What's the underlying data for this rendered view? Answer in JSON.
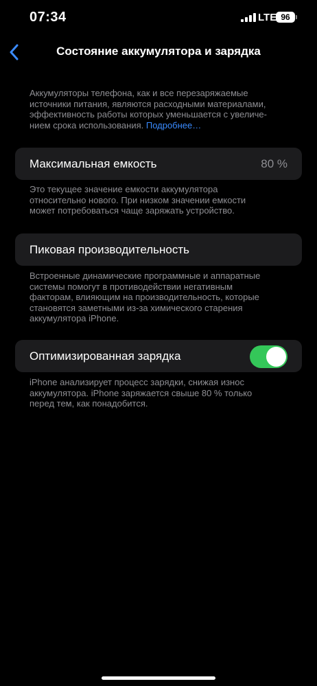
{
  "status_bar": {
    "time": "07:34",
    "network": "LTE",
    "battery": "96"
  },
  "nav": {
    "title": "Состояние аккумулятора и зарядка"
  },
  "intro": {
    "lines": [
      "Аккумуляторы телефона, как и все перезаряжаемые",
      "источники питания, являются расходными материалами,",
      "эффективность работы которых уменьшается с увеличе-",
      "нием срока использования. "
    ],
    "link": "Подробнее…"
  },
  "max_capacity": {
    "label": "Максимальная емкость",
    "value": "80 %",
    "note_lines": [
      "Это текущее значение емкости аккумулятора",
      "относительно нового. При низком значении емкости",
      "может потребоваться чаще заряжать устройство."
    ]
  },
  "peak_performance": {
    "label": "Пиковая производительность",
    "note_lines": [
      "Встроенные динамические программные и аппаратные",
      "системы помогут в противодействии негативным",
      "факторам, влияющим на производительность, которые",
      "становятся заметными из-за химического старения",
      "аккумулятора iPhone."
    ]
  },
  "optimized_charging": {
    "label": "Оптимизированная зарядка",
    "enabled": true,
    "note_lines": [
      "iPhone анализирует процесс зарядки, снижая износ",
      "аккумулятора. iPhone заряжается свыше 80 % только",
      "перед тем, как понадобится."
    ]
  },
  "colors": {
    "accent": "#3a8bff",
    "toggle_on": "#34c759",
    "cell_bg": "#1c1c1e",
    "secondary_text": "#8e8e93"
  }
}
